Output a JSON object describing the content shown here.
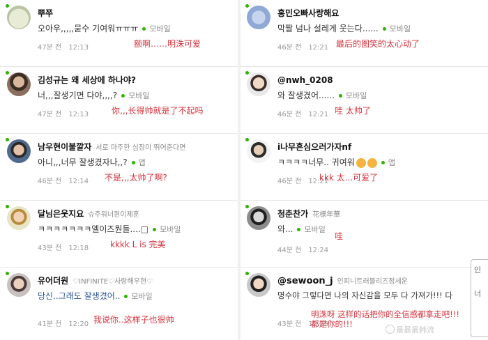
{
  "left_comments": [
    {
      "name": "뿌쭈",
      "subname": "",
      "text": "오아우,,,,,묻수 기여워ㅠㅠㅠ",
      "source": "모바일",
      "ago": "47분 전",
      "time": "12:13",
      "translation": "额啊……明洙可爱"
    },
    {
      "name": "김성규는 왜 세상에 하나야?",
      "subname": "",
      "text": "너,,,잘생기면 다야,,,,?",
      "source": "모바일",
      "ago": "47분 전",
      "time": "12:13",
      "translation": "你,,,长得帅就是了不起吗"
    },
    {
      "name": "남우현이불깔자",
      "subname": "서로 마주한 심장이 뛰어준다면",
      "text": "아니,,,너무 잘생겼자나,,?",
      "source": "앱",
      "ago": "46분 전",
      "time": "12:14",
      "translation": "不是,,,太帅了啊?"
    },
    {
      "name": "달님은웃지요",
      "subname": "슈주워너원이제훈",
      "text": "ㅋㅋㅋㅋㅋㅋㅋ엘이즈뭔들....□",
      "source": "모바일",
      "ago": "43분 전",
      "time": "12:18",
      "translation": "kkkk L is 完美"
    },
    {
      "name": "유어더원",
      "subname": "♡INFINITE♡사랑해우현♡",
      "text": "당신..그래도 잘생겼어..",
      "source": "모바일",
      "ago": "41분 전",
      "time": "12:20",
      "translation": "我说你..这样子也很帅"
    }
  ],
  "right_comments": [
    {
      "name": "홍민오빠사랑해요",
      "subname": "",
      "text": "막짤 넘나 설레게 웃는다......",
      "source": "모바일",
      "ago": "46분 전",
      "time": "12:21",
      "translation": "最后的图笑的太心动了"
    },
    {
      "name": "@nwh_0208",
      "subname": "",
      "text": "와 잘생겼어......",
      "source": "모바일",
      "ago": "46분 전",
      "time": "12:21",
      "translation": "哇 太帅了"
    },
    {
      "name": "i나무흔심으러가자nf",
      "subname": "",
      "text": "ㅋㅋㅋㅋ너무.. 귀여워",
      "source": "앱",
      "ago": "46분 전",
      "time": "12:21",
      "translation": "kkk 太...可爱了"
    },
    {
      "name": "청춘찬가",
      "subname": "花様年華",
      "text": "와...",
      "source": "모바일",
      "ago": "44분 전",
      "time": "12:24",
      "translation": "哇"
    },
    {
      "name": "@sewoon_j",
      "subname": "인피니트러블리즈정세운",
      "text": "명수야 그렇다면 나의 자신감을 모두 다 가져가!!! 다",
      "source": "",
      "ago": "43분 전",
      "time": "12:25",
      "translation": "明洙呀 这样的话把你的全信感都拿走吧!!!\n都是你的!!!"
    }
  ],
  "popup": {
    "line1": "인",
    "line2": "너"
  },
  "watermark": "最最最韩流",
  "colors": {
    "accent_green": "#2db400",
    "translation_red": "#d5333d",
    "name_blue": "#2a5599"
  }
}
